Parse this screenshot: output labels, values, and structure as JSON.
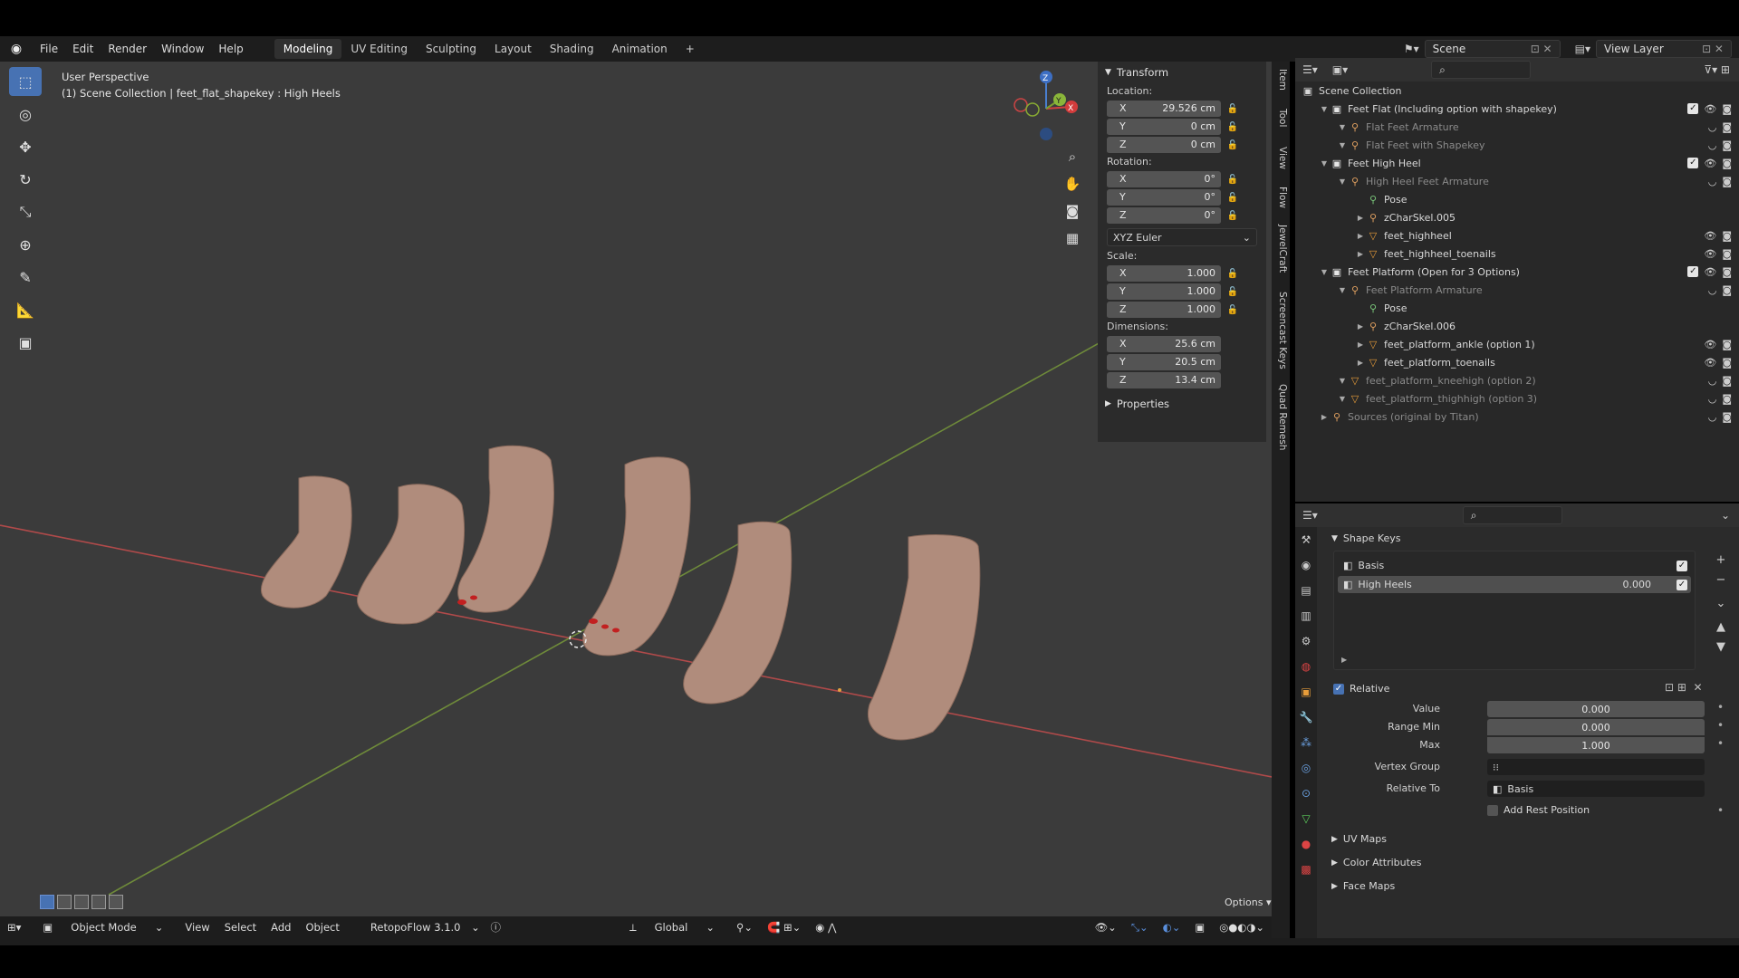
{
  "topbar": {
    "menus": [
      "File",
      "Edit",
      "Render",
      "Window",
      "Help"
    ],
    "workspaces": [
      "Modeling",
      "UV Editing",
      "Sculpting",
      "Layout",
      "Shading",
      "Animation"
    ],
    "active_workspace": "Modeling",
    "add_tab": "+",
    "scene_name": "Scene",
    "view_layer": "View Layer"
  },
  "viewport": {
    "title": "User Perspective",
    "subtitle": "(1) Scene Collection | feet_flat_shapekey : High Heels",
    "gizmo": {
      "x": "X",
      "y": "Y",
      "z": "Z"
    },
    "options_label": "Options"
  },
  "npanel": {
    "section": "Transform",
    "location_label": "Location:",
    "location": [
      {
        "axis": "X",
        "value": "29.526 cm"
      },
      {
        "axis": "Y",
        "value": "0 cm"
      },
      {
        "axis": "Z",
        "value": "0 cm"
      }
    ],
    "rotation_label": "Rotation:",
    "rotation": [
      {
        "axis": "X",
        "value": "0°"
      },
      {
        "axis": "Y",
        "value": "0°"
      },
      {
        "axis": "Z",
        "value": "0°"
      }
    ],
    "rotation_mode": "XYZ Euler",
    "scale_label": "Scale:",
    "scale": [
      {
        "axis": "X",
        "value": "1.000"
      },
      {
        "axis": "Y",
        "value": "1.000"
      },
      {
        "axis": "Z",
        "value": "1.000"
      }
    ],
    "dimensions_label": "Dimensions:",
    "dimensions": [
      {
        "axis": "X",
        "value": "25.6 cm"
      },
      {
        "axis": "Y",
        "value": "20.5 cm"
      },
      {
        "axis": "Z",
        "value": "13.4 cm"
      }
    ],
    "properties_label": "Properties"
  },
  "vtabs": [
    "Item",
    "Tool",
    "View",
    "Flow",
    "JewelCraft",
    "Screencast Keys",
    "Quad Remesh"
  ],
  "outliner": {
    "root": "Scene Collection",
    "rows": [
      {
        "label": "Feet Flat (Including option with shapekey)",
        "indent": 1,
        "icon": "collection",
        "dim": false
      },
      {
        "label": "Flat Feet Armature",
        "indent": 2,
        "icon": "armature",
        "dim": true
      },
      {
        "label": "Flat Feet with Shapekey",
        "indent": 2,
        "icon": "armature",
        "dim": true
      },
      {
        "label": "Feet High Heel",
        "indent": 1,
        "icon": "collection",
        "dim": false
      },
      {
        "label": "High Heel Feet Armature",
        "indent": 2,
        "icon": "armature",
        "dim": true
      },
      {
        "label": "Pose",
        "indent": 3,
        "icon": "pose",
        "dim": false
      },
      {
        "label": "zCharSkel.005",
        "indent": 3,
        "icon": "armature",
        "dim": false
      },
      {
        "label": "feet_highheel",
        "indent": 3,
        "icon": "mesh",
        "dim": false
      },
      {
        "label": "feet_highheel_toenails",
        "indent": 3,
        "icon": "mesh",
        "dim": false
      },
      {
        "label": "Feet Platform (Open for 3 Options)",
        "indent": 1,
        "icon": "collection",
        "dim": false
      },
      {
        "label": "Feet Platform Armature",
        "indent": 2,
        "icon": "armature",
        "dim": true
      },
      {
        "label": "Pose",
        "indent": 3,
        "icon": "pose",
        "dim": false
      },
      {
        "label": "zCharSkel.006",
        "indent": 3,
        "icon": "armature",
        "dim": false
      },
      {
        "label": "feet_platform_ankle (option 1)",
        "indent": 3,
        "icon": "mesh",
        "dim": false
      },
      {
        "label": "feet_platform_toenails",
        "indent": 3,
        "icon": "mesh",
        "dim": false
      },
      {
        "label": "feet_platform_kneehigh (option 2)",
        "indent": 2,
        "icon": "mesh",
        "dim": true
      },
      {
        "label": "feet_platform_thighhigh (option 3)",
        "indent": 2,
        "icon": "mesh",
        "dim": true
      },
      {
        "label": "Sources (original by Titan)",
        "indent": 1,
        "icon": "armature",
        "dim": true
      }
    ]
  },
  "properties": {
    "section": "Shape Keys",
    "keys": [
      {
        "name": "Basis",
        "value": ""
      },
      {
        "name": "High Heels",
        "value": "0.000"
      }
    ],
    "relative_label": "Relative",
    "value_label": "Value",
    "value": "0.000",
    "range_min_label": "Range Min",
    "range_min": "0.000",
    "max_label": "Max",
    "max": "1.000",
    "vertex_group_label": "Vertex Group",
    "relative_to_label": "Relative To",
    "relative_to": "Basis",
    "add_rest_label": "Add Rest Position",
    "sections": [
      "UV Maps",
      "Color Attributes",
      "Face Maps"
    ]
  },
  "bottombar": {
    "mode": "Object Mode",
    "menus": [
      "View",
      "Select",
      "Add",
      "Object"
    ],
    "addon": "RetopoFlow 3.1.0",
    "orientation": "Global"
  }
}
